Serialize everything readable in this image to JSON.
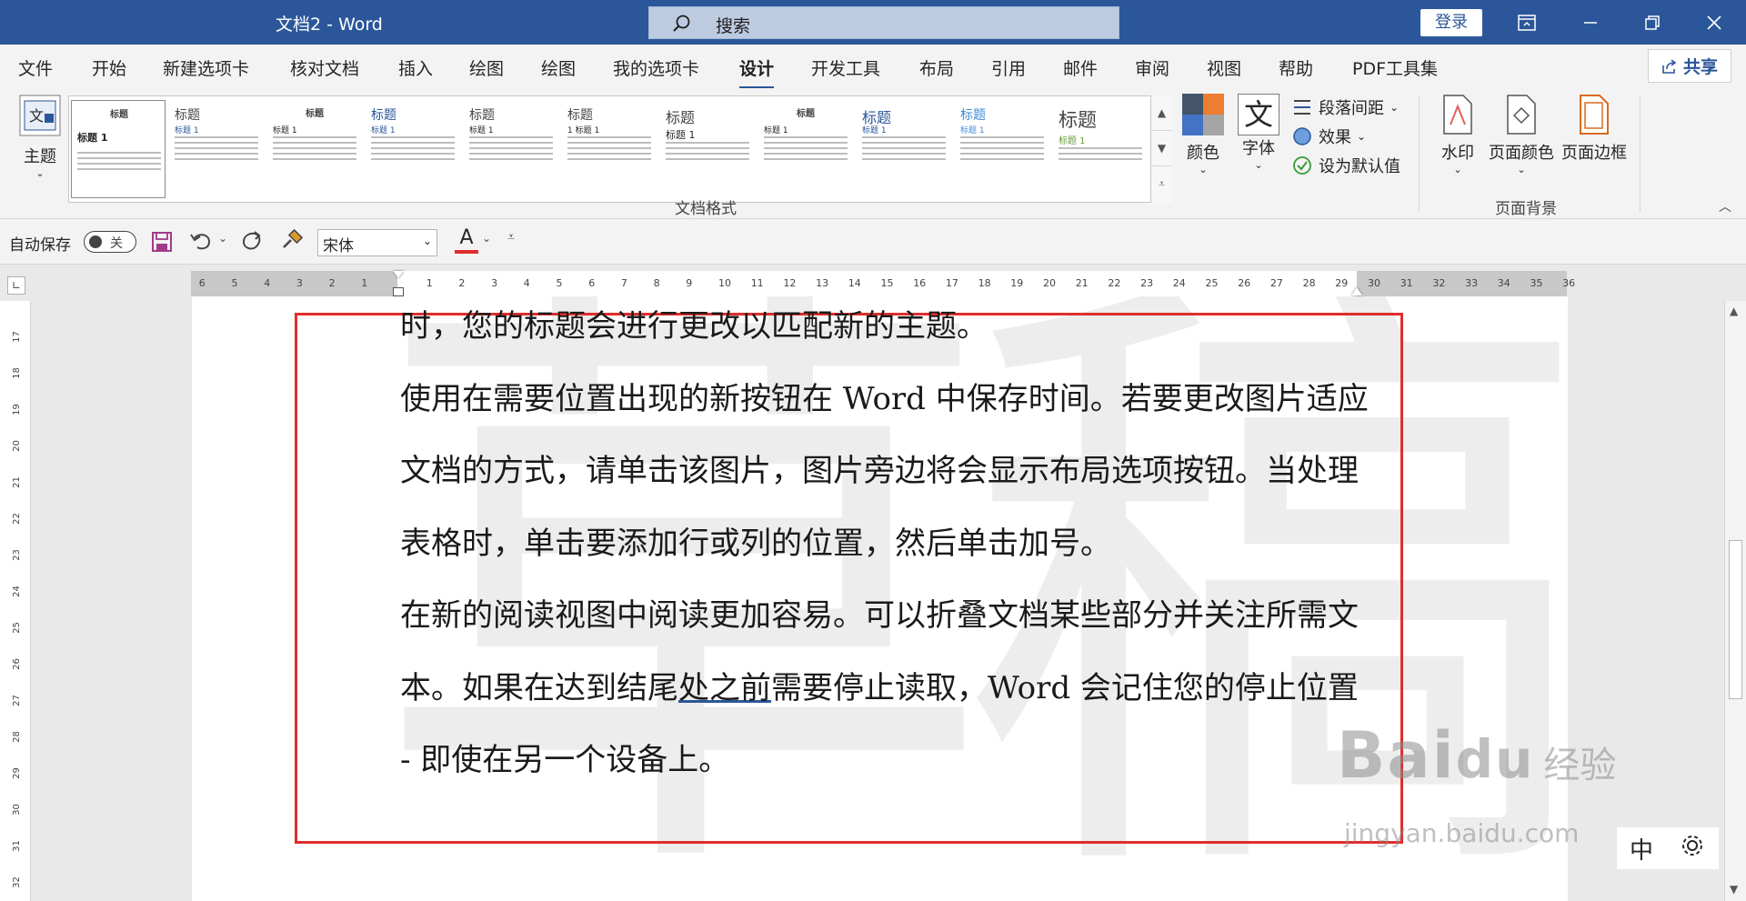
{
  "titlebar": {
    "title": "文档2  -  Word",
    "search_label": "搜索",
    "login_label": "登录"
  },
  "menu": {
    "items": [
      "文件",
      "开始",
      "新建选项卡",
      "核对文档",
      "插入",
      "绘图",
      "绘图",
      "我的选项卡",
      "设计",
      "开发工具",
      "布局",
      "引用",
      "邮件",
      "审阅",
      "视图",
      "帮助",
      "PDF工具集"
    ],
    "active_index": 8,
    "share_label": "共享"
  },
  "ribbon": {
    "theme_label": "主题",
    "gallery_styles": [
      {
        "heading": "标题",
        "subheading": "标题 1"
      },
      {
        "heading": "标题",
        "subheading": "标题 1"
      },
      {
        "heading": "标题",
        "subheading": "标题 1"
      },
      {
        "heading": "标题",
        "subheading": "标题 1"
      },
      {
        "heading": "标题",
        "subheading": "标题 1"
      },
      {
        "heading": "标题",
        "subheading": "1  标题 1"
      },
      {
        "heading": "标题",
        "subheading": "标题 1"
      },
      {
        "heading": "标题",
        "subheading": "标题 1"
      },
      {
        "heading": "标题",
        "subheading": "标题 1"
      },
      {
        "heading": "标题",
        "subheading": "标题 1"
      },
      {
        "heading": "标题",
        "subheading": "标题 1"
      }
    ],
    "doc_format_label": "文档格式",
    "colors_label": "颜色",
    "fonts_label": "字体",
    "fonts_glyph": "文",
    "paragraph_spacing_label": "段落间距",
    "effects_label": "效果",
    "set_default_label": "设为默认值",
    "watermark_label": "水印",
    "page_color_label": "页面颜色",
    "page_border_label": "页面边框",
    "page_background_label": "页面背景"
  },
  "qat": {
    "autosave_label": "自动保存",
    "toggle_state": "关",
    "font_name": "宋体",
    "font_color_glyph": "A",
    "font_color": "#e02d2d"
  },
  "document": {
    "paragraphs": [
      "时，您的标题会进行更改以匹配新的主题。",
      "使用在需要位置出现的新按钮在 Word 中保存时间。若要更改图片适应文档的方式，请单击该图片，图片旁边将会显示布局选项按钮。当处理表格时，单击要添加行或列的位置，然后单击加号。",
      "在新的阅读视图中阅读更加容易。可以折叠文档某些部分并关注所需文本。如果在达到结尾处之前需要停止读取，Word 会记住您的停止位置 - 即使在另一个设备上。"
    ],
    "watermark_text": "草稿"
  },
  "overlay": {
    "brand": "Bai",
    "brand2": "du",
    "brand_cn": "经验",
    "brand_url": "jingyan.baidu.com",
    "ime_label": "中"
  },
  "colors": {
    "word_blue": "#2b579a",
    "highlight_red": "#e02d2d"
  }
}
